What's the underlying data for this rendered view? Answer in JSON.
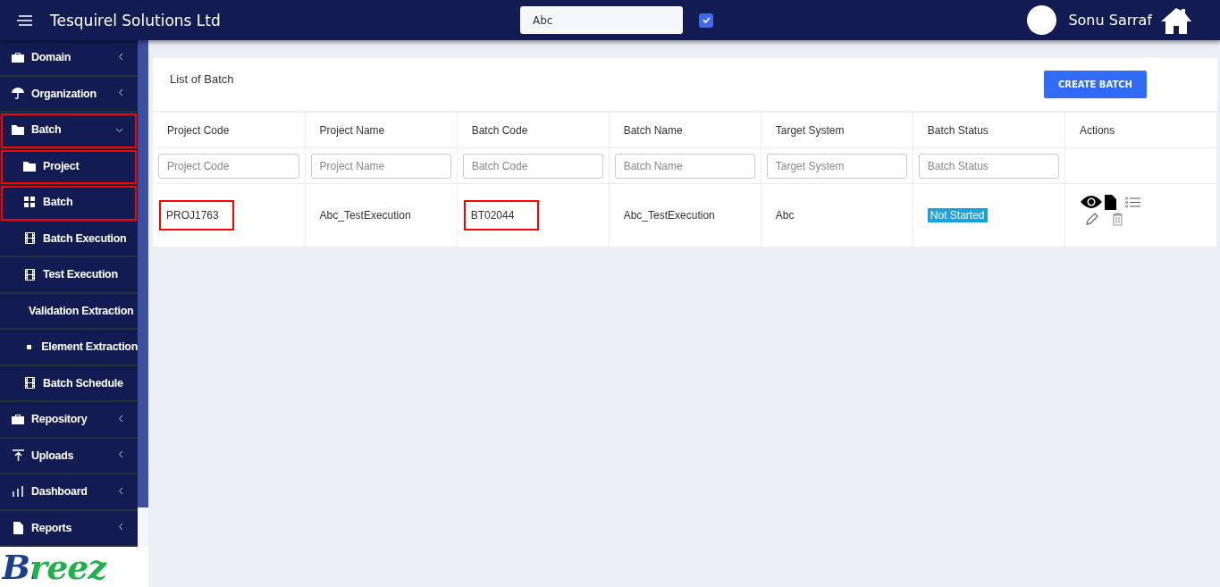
{
  "header": {
    "title": "Tesquirel Solutions Ltd",
    "search_value": "Abc",
    "checkbox_checked": true,
    "user_name": "Sonu Sarraf"
  },
  "sidebar": {
    "items": [
      {
        "label": "Domain",
        "expanded": false,
        "highlighted": false
      },
      {
        "label": "Organization",
        "expanded": false,
        "highlighted": false
      },
      {
        "label": "Batch",
        "expanded": true,
        "highlighted": true,
        "children": [
          {
            "label": "Project",
            "highlighted": true
          },
          {
            "label": "Batch",
            "highlighted": true
          },
          {
            "label": "Batch Execution",
            "highlighted": false
          },
          {
            "label": "Test Execution",
            "highlighted": false
          },
          {
            "label": "Validation Extraction",
            "highlighted": false
          },
          {
            "label": "Element Extraction",
            "highlighted": false
          },
          {
            "label": "Batch Schedule",
            "highlighted": false
          }
        ]
      },
      {
        "label": "Repository",
        "expanded": false,
        "highlighted": false
      },
      {
        "label": "Uploads",
        "expanded": false,
        "highlighted": false
      },
      {
        "label": "Dashboard",
        "expanded": false,
        "highlighted": false
      },
      {
        "label": "Reports",
        "expanded": false,
        "highlighted": false
      }
    ],
    "logo_text": "Breez"
  },
  "card": {
    "title": "List of Batch",
    "create_button": "CREATE BATCH",
    "columns": [
      {
        "label": "Project Code",
        "placeholder": "Project Code"
      },
      {
        "label": "Project Name",
        "placeholder": "Project Name"
      },
      {
        "label": "Batch Code",
        "placeholder": "Batch Code"
      },
      {
        "label": "Batch Name",
        "placeholder": "Batch Name"
      },
      {
        "label": "Target System",
        "placeholder": "Target System"
      },
      {
        "label": "Batch Status",
        "placeholder": "Batch Status"
      },
      {
        "label": "Actions"
      }
    ],
    "rows": [
      {
        "cells": [
          {
            "text": "PROJ1763",
            "highlighted": true
          },
          {
            "text": "Abc_TestExecution",
            "highlighted": false
          },
          {
            "text": "BT02044",
            "highlighted": true
          },
          {
            "text": "Abc_TestExecution",
            "highlighted": false
          },
          {
            "text": "Abc",
            "highlighted": false
          },
          {
            "text": "Not Started",
            "kind": "status",
            "highlighted": false
          }
        ]
      }
    ]
  }
}
